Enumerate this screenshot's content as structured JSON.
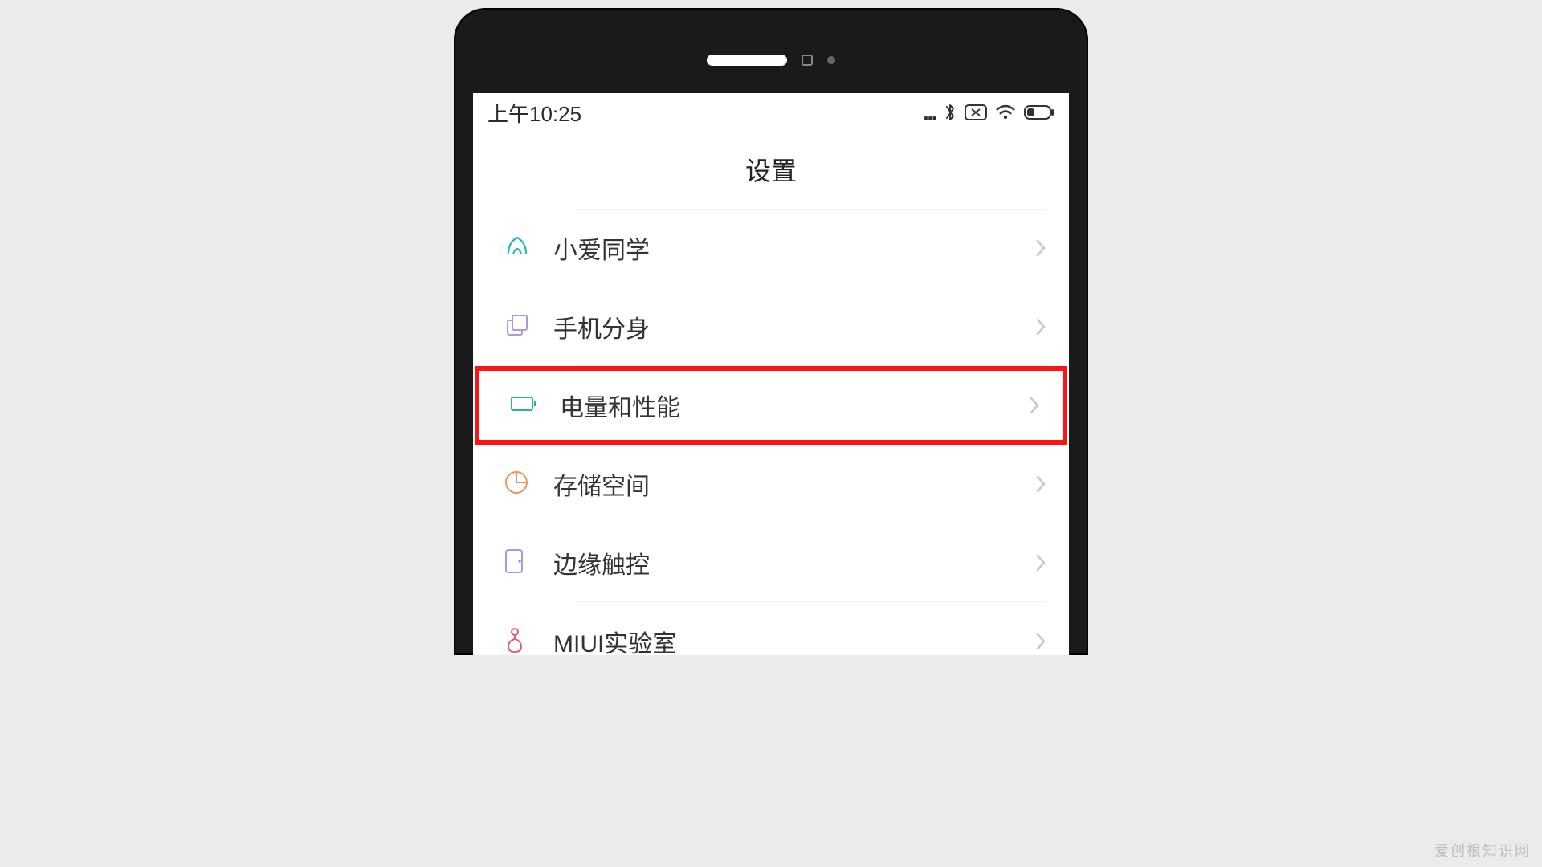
{
  "watermark": "爱创根知识网",
  "status_bar": {
    "time": "上午10:25",
    "more_dots": "..."
  },
  "header": {
    "title": "设置"
  },
  "settings": {
    "items": [
      {
        "label": "小爱同学",
        "icon": "xiaoai",
        "highlighted": false
      },
      {
        "label": "手机分身",
        "icon": "dual-apps",
        "highlighted": false
      },
      {
        "label": "电量和性能",
        "icon": "battery",
        "highlighted": true
      },
      {
        "label": "存储空间",
        "icon": "storage",
        "highlighted": false
      },
      {
        "label": "边缘触控",
        "icon": "edge-touch",
        "highlighted": false
      },
      {
        "label": "MIUI实验室",
        "icon": "miui-lab",
        "highlighted": false
      }
    ]
  }
}
